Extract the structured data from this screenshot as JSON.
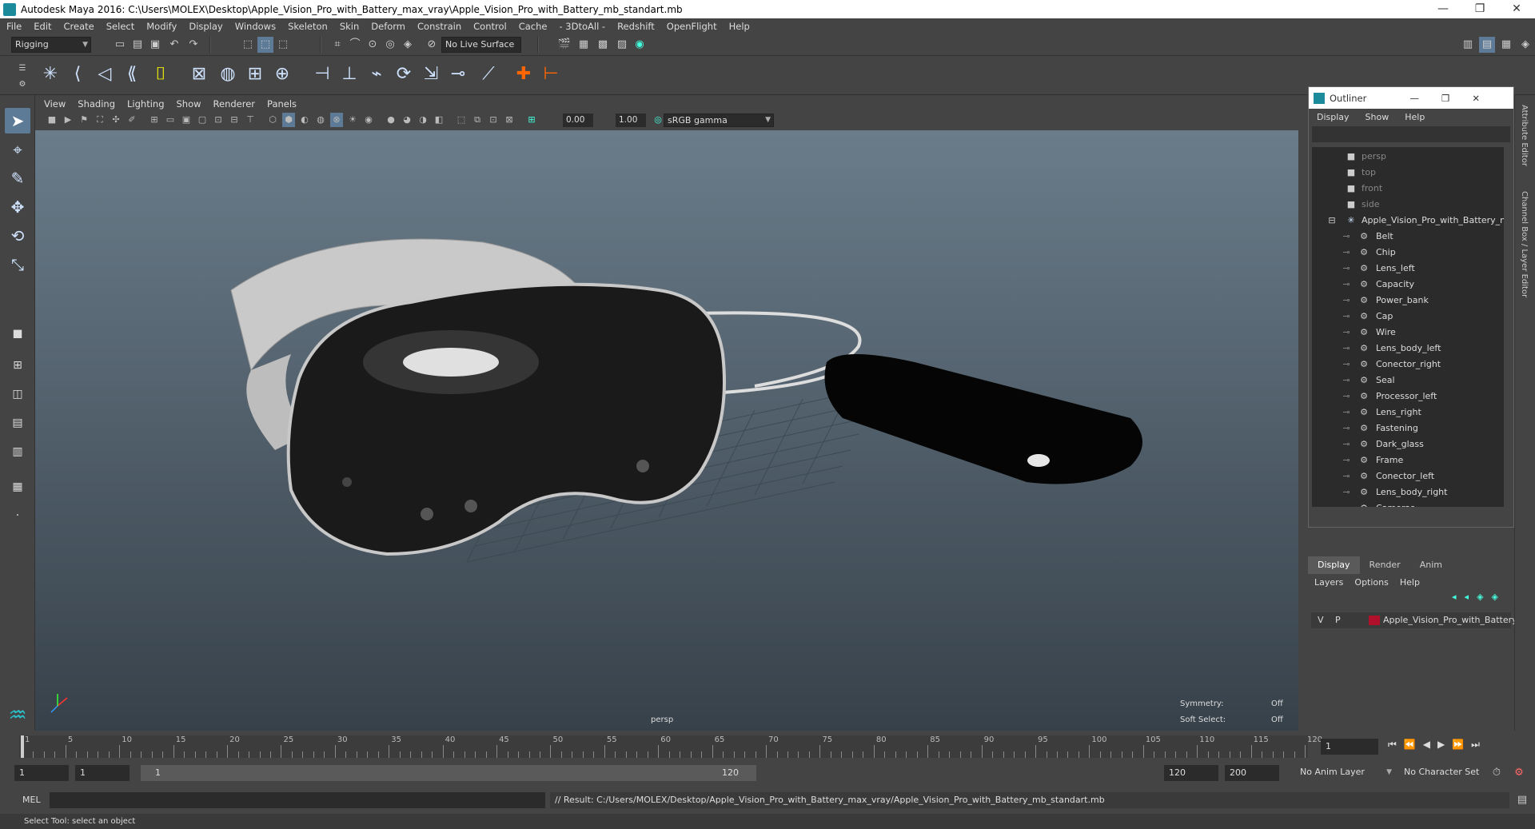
{
  "window": {
    "title": "Autodesk Maya 2016: C:\\Users\\MOLEX\\Desktop\\Apple_Vision_Pro_with_Battery_max_vray\\Apple_Vision_Pro_with_Battery_mb_standart.mb",
    "controls": {
      "minimize": "—",
      "restore": "❐",
      "close": "✕"
    }
  },
  "menubar": [
    "File",
    "Edit",
    "Create",
    "Select",
    "Modify",
    "Display",
    "Windows",
    "Skeleton",
    "Skin",
    "Deform",
    "Constrain",
    "Control",
    "Cache",
    "- 3DtoAll -",
    "Redshift",
    "OpenFlight",
    "Help"
  ],
  "statusline": {
    "menu_set": "Rigging",
    "live_surface": "No Live Surface"
  },
  "panel": {
    "menus": [
      "View",
      "Shading",
      "Lighting",
      "Show",
      "Renderer",
      "Panels"
    ],
    "near": "0.00",
    "far": "1.00",
    "color_space": "sRGB gamma"
  },
  "viewport": {
    "camera_label": "persp",
    "symmetry_label": "Symmetry:",
    "symmetry_value": "Off",
    "soft_select_label": "Soft Select:",
    "soft_select_value": "Off"
  },
  "outliner": {
    "title": "Outliner",
    "menus": [
      "Display",
      "Show",
      "Help"
    ],
    "cameras": [
      "persp",
      "top",
      "front",
      "side"
    ],
    "group": "Apple_Vision_Pro_with_Battery_ncl",
    "items": [
      "Belt",
      "Chip",
      "Lens_left",
      "Capacity",
      "Power_bank",
      "Cap",
      "Wire",
      "Lens_body_left",
      "Conector_right",
      "Seal",
      "Processor_left",
      "Lens_right",
      "Fastening",
      "Dark_glass",
      "Frame",
      "Conector_left",
      "Lens_body_right",
      "Cameras"
    ]
  },
  "layer_editor": {
    "tabs": [
      "Display",
      "Render",
      "Anim"
    ],
    "menus": [
      "Layers",
      "Options",
      "Help"
    ],
    "layer": {
      "v": "V",
      "p": "P",
      "name": "Apple_Vision_Pro_with_Battery",
      "color": "#b0102a"
    }
  },
  "right_strip": {
    "attribute_editor": "Attribute Editor",
    "channel_box": "Channel Box / Layer Editor"
  },
  "timeline": {
    "ticks": [
      "1",
      "5",
      "10",
      "15",
      "20",
      "25",
      "30",
      "35",
      "40",
      "45",
      "50",
      "55",
      "60",
      "65",
      "70",
      "75",
      "80",
      "85",
      "90",
      "95",
      "100",
      "105",
      "110",
      "115",
      "120"
    ],
    "current_frame": "1"
  },
  "range": {
    "start": "1",
    "playback_start": "1",
    "slider_start": "1",
    "slider_end": "120",
    "playback_end": "120",
    "end": "200",
    "anim_layer": "No Anim Layer",
    "character_set": "No Character Set"
  },
  "commandline": {
    "label": "MEL",
    "result": "// Result: C:/Users/MOLEX/Desktop/Apple_Vision_Pro_with_Battery_max_vray/Apple_Vision_Pro_with_Battery_mb_standart.mb"
  },
  "helpline": "Select Tool: select an object"
}
